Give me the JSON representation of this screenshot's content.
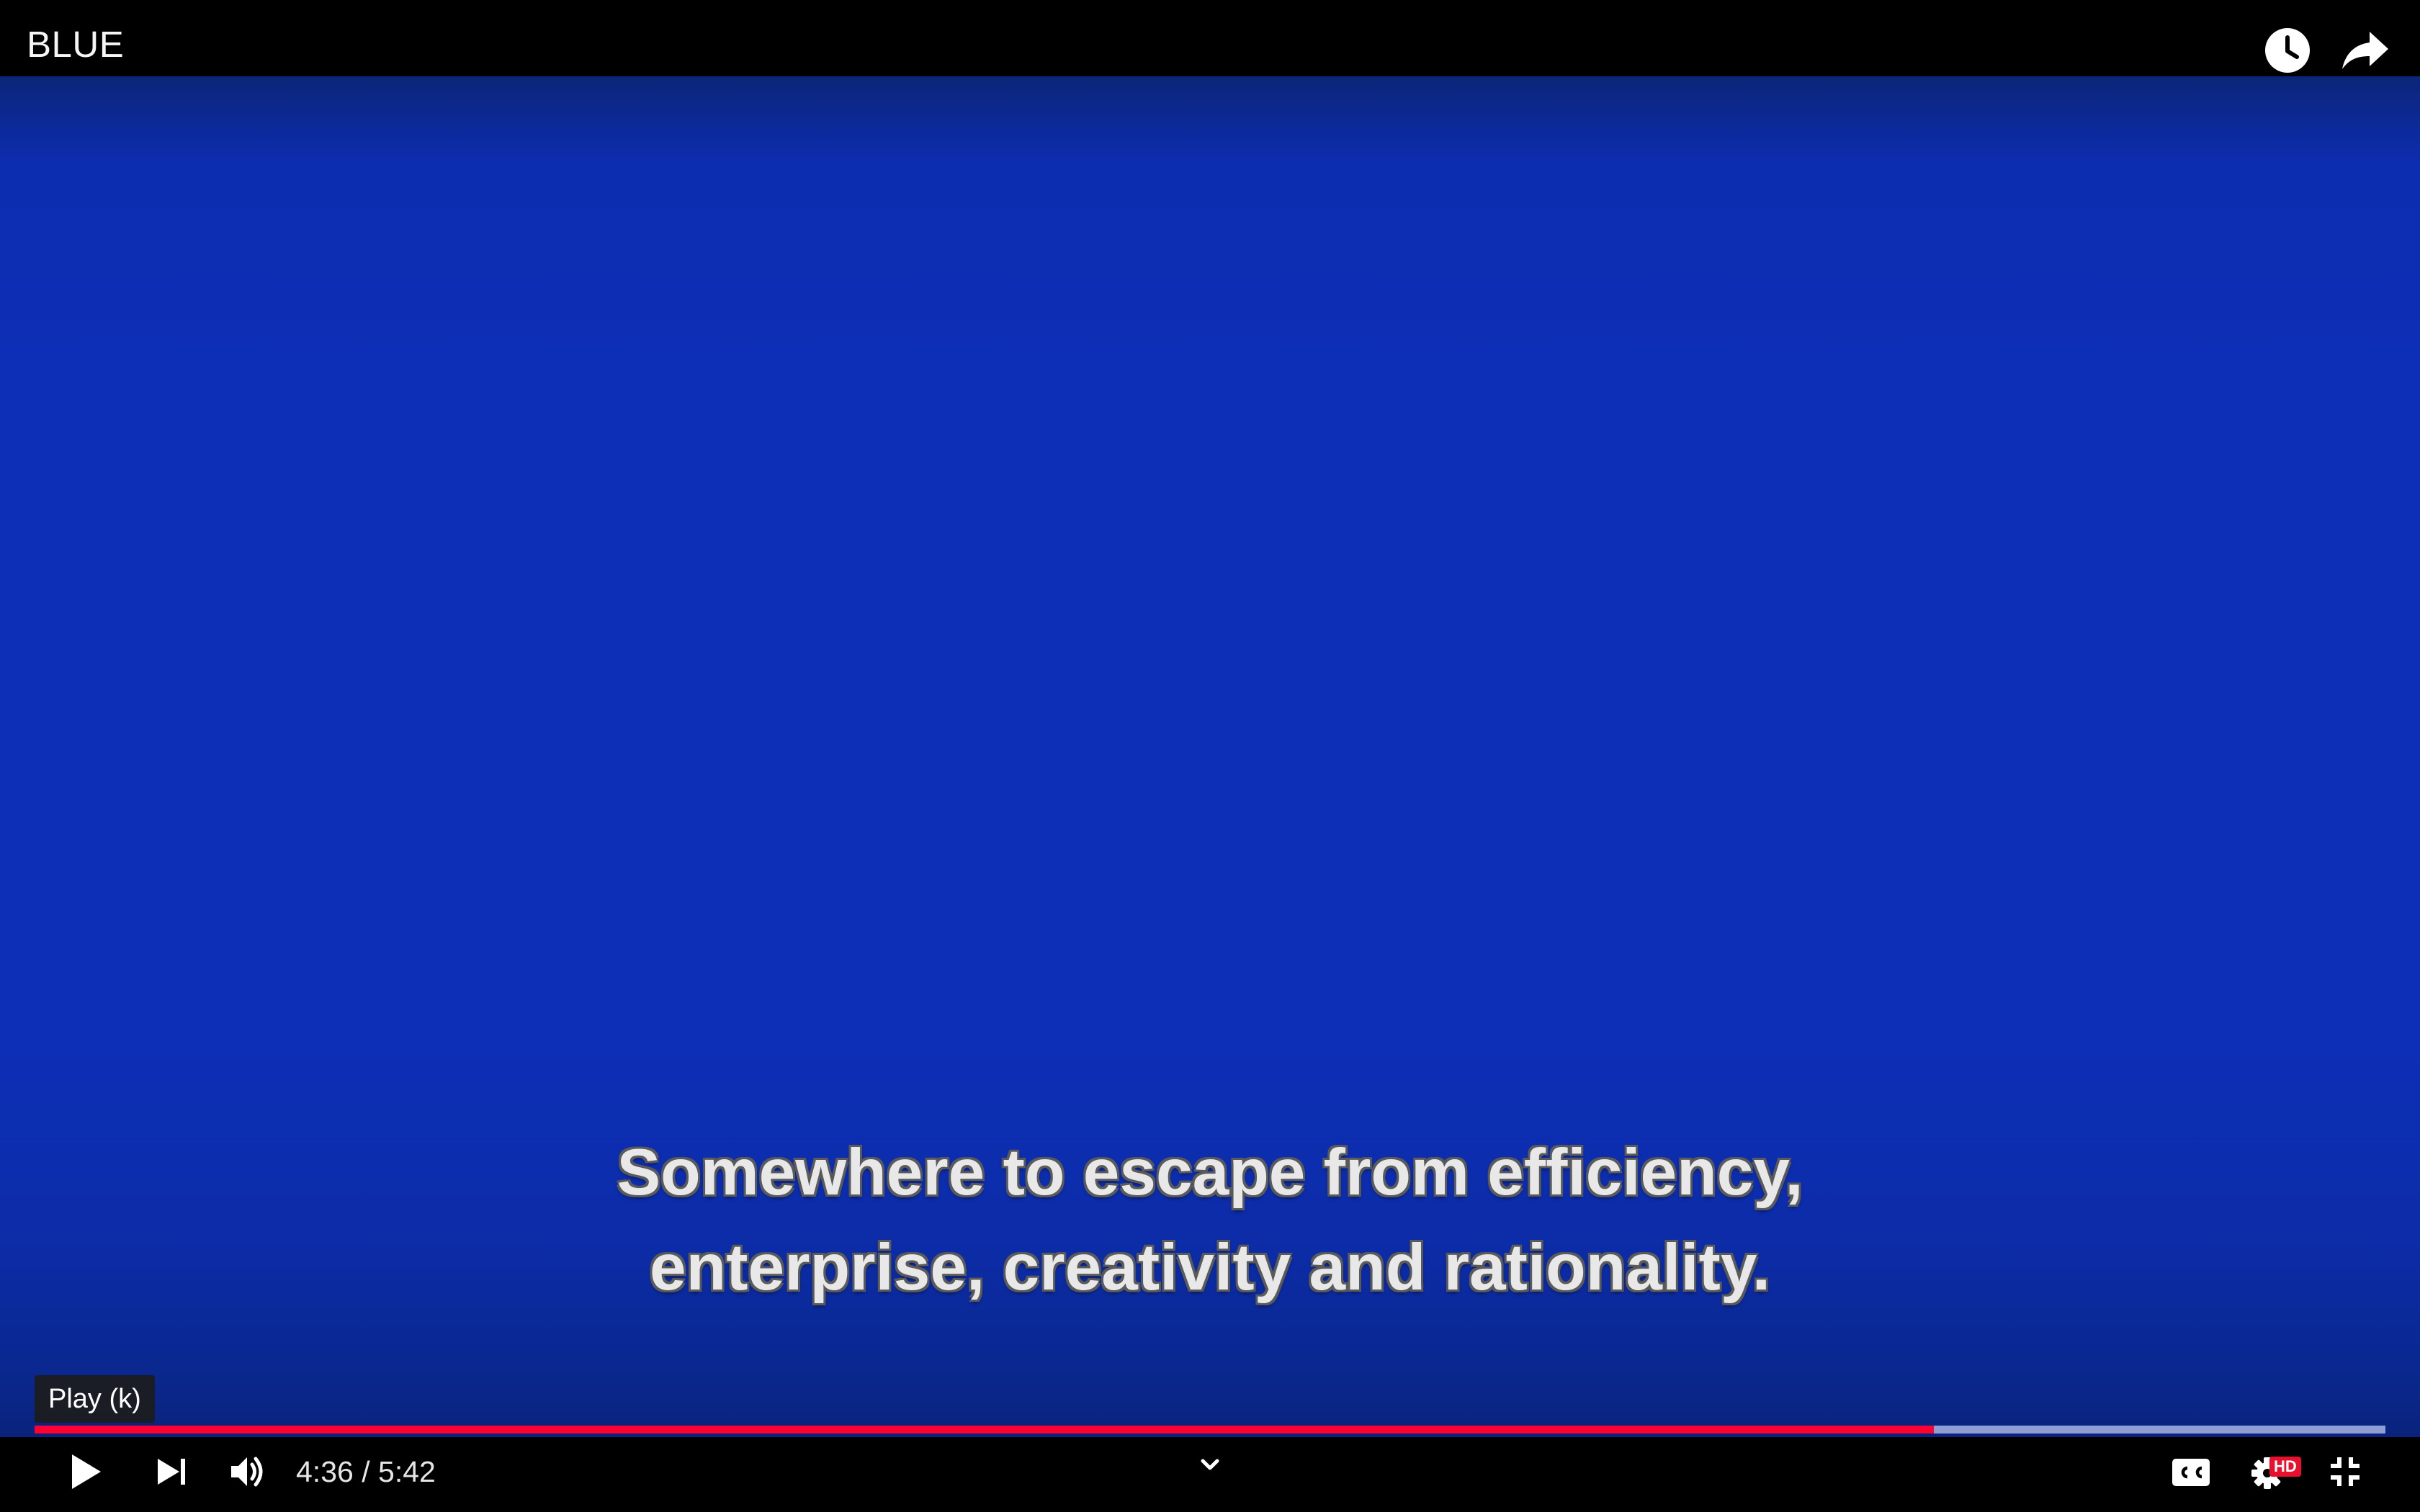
{
  "player": {
    "title": "BLUE",
    "tooltip": "Play (k)",
    "time": {
      "current": "4:36",
      "separator": "/",
      "duration": "5:42"
    },
    "progress": {
      "played_fraction": 0.808,
      "loaded_fraction": 1.0
    },
    "settings_badge": "HD"
  },
  "subtitles": {
    "line1": "Somewhere to escape from efficiency,",
    "line2": "enterprise, creativity and rationality."
  },
  "icons": {
    "top_bar": [
      "watch-later-icon",
      "share-icon"
    ],
    "controls": [
      "play-icon",
      "next-icon",
      "volume-icon",
      "chevron-down-icon",
      "captions-icon",
      "settings-icon",
      "exit-fullscreen-icon"
    ]
  },
  "colors": {
    "video_background": "#0d2fb8",
    "progress_played": "#ff0033",
    "progress_loaded": "#8f9fd6",
    "hd_badge": "#e8112d",
    "chrome_background": "#000000"
  }
}
